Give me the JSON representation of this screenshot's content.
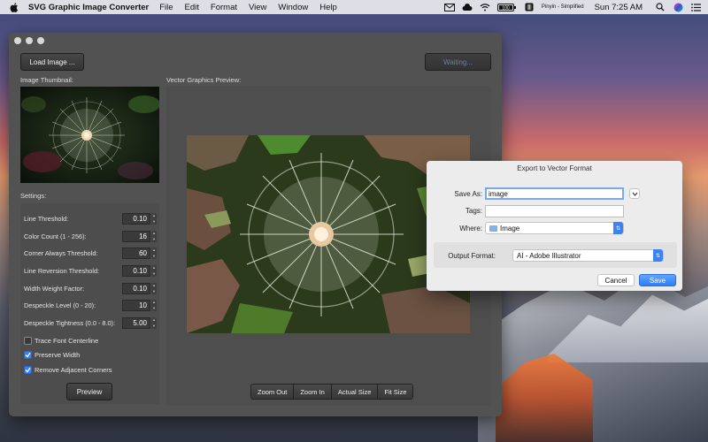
{
  "menubar": {
    "app_name": "SVG Graphic Image Converter",
    "menus": [
      "File",
      "Edit",
      "Format",
      "View",
      "Window",
      "Help"
    ],
    "battery": "100",
    "input_source": "Pinyin - Simplified",
    "clock": "Sun 7:25 AM"
  },
  "toolbar": {
    "load_label": "Load Image ...",
    "waiting_label": "Waiting..."
  },
  "thumbnail": {
    "label": "Image Thumbnail:"
  },
  "preview": {
    "label": "Vector Graphics Preview:"
  },
  "settings": {
    "label": "Settings:",
    "rows": [
      {
        "label": "Line Threshold:",
        "value": "0.10"
      },
      {
        "label": "Color Count (1 - 256):",
        "value": "16"
      },
      {
        "label": "Corner Always Threshold:",
        "value": "60"
      },
      {
        "label": "Line Reversion Threshold:",
        "value": "0.10"
      },
      {
        "label": "Width Weight Factor:",
        "value": "0.10"
      },
      {
        "label": "Despeckle Level (0 - 20):",
        "value": "10"
      },
      {
        "label": "Despeckle Tightness (0.0 - 8.0):",
        "value": "5.00"
      }
    ],
    "checks": [
      {
        "label": "Trace Font Centerline",
        "checked": false
      },
      {
        "label": "Preserve Width",
        "checked": true
      },
      {
        "label": "Remove Adjacent Corners",
        "checked": true
      }
    ],
    "preview_button": "Preview"
  },
  "zoom": {
    "zoom_out": "Zoom Out",
    "zoom_in": "Zoom In",
    "actual_size": "Actual Size",
    "fit_size": "Fit Size"
  },
  "dialog": {
    "title": "Export to Vector Format",
    "save_as_label": "Save As:",
    "save_as_value": "image",
    "tags_label": "Tags:",
    "tags_value": "",
    "where_label": "Where:",
    "where_value": "Image",
    "output_format_label": "Output Format:",
    "output_format_value": "AI - Adobe Illustrator",
    "cancel_label": "Cancel",
    "save_label": "Save"
  },
  "colors": {
    "accent": "#3b82f6",
    "window_bg": "#525252",
    "dialog_bg": "#ececec",
    "waiting_text": "#6a7fa8"
  }
}
